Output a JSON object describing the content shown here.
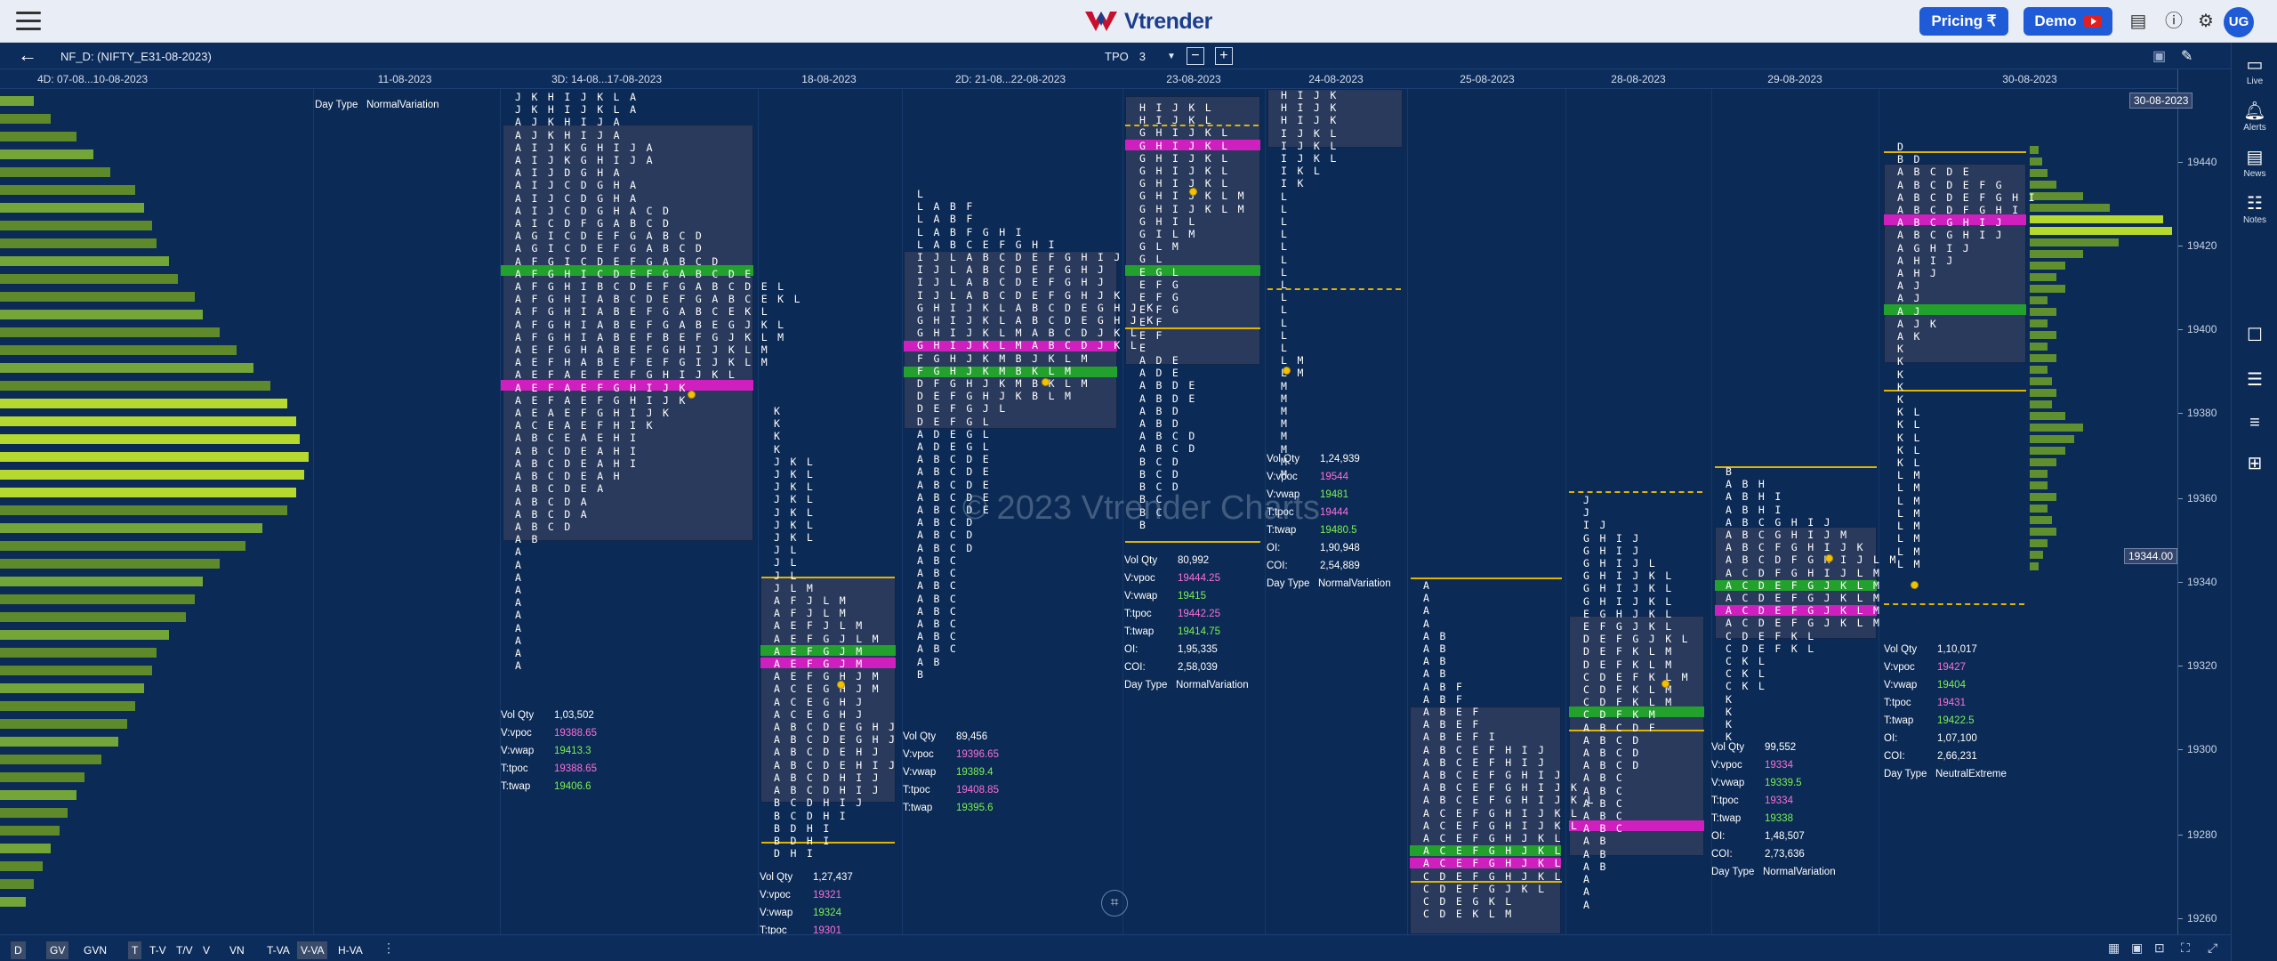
{
  "navbar": {
    "logo_text": "Vtrender",
    "pricing_label": "Pricing ₹",
    "demo_label": "Demo",
    "avatar_initials": "UG",
    "icons": [
      "menu-icon",
      "document-icon",
      "info-icon",
      "gear-icon"
    ]
  },
  "toolbar": {
    "symbol": "NF_D: (NIFTY_E31-08-2023)",
    "tpo_label": "TPO",
    "tpo_value": "3",
    "zoom_out": "−",
    "zoom_in": "+"
  },
  "right_sidebar": {
    "items": [
      {
        "icon": "live-icon",
        "label": "Live"
      },
      {
        "icon": "alerts-icon",
        "label": "Alerts"
      },
      {
        "icon": "news-icon",
        "label": "News"
      },
      {
        "icon": "notes-icon",
        "label": "Notes"
      }
    ]
  },
  "date_headers": [
    "4D: 07-08...10-08-2023",
    "11-08-2023",
    "3D: 14-08...17-08-2023",
    "18-08-2023",
    "2D: 21-08...22-08-2023",
    "23-08-2023",
    "24-08-2023",
    "25-08-2023",
    "28-08-2023",
    "29-08-2023",
    "30-08-2023"
  ],
  "y_axis": {
    "ticks": [
      "19440",
      "19420",
      "19400",
      "19380",
      "19360",
      "19340",
      "19320",
      "19300",
      "19280",
      "19260"
    ],
    "top_label": "30-08-2023",
    "cursor_price": "19344.00"
  },
  "day_type_header": {
    "label": "Day Type",
    "value": "NormalVariation"
  },
  "profiles": {
    "p3d": {
      "rows": [
        "J K H I J K L A",
        "J K H I J K L A",
        "A J K H I J A",
        "A J K H I J A",
        "A I J K G H I J A",
        "A I J K G H I J A",
        "A I J D G H A",
        "A I J C D G H A",
        "A I J C D G H A",
        "A I J C D G H A C D",
        "A I C D F G A B C D",
        "A G I C D E F G A B C D",
        "A G I C D E F G A B C D",
        "A F G I C D E F G A B C D",
        "A F G H I C D E F G A B C D E",
        "A F G H I B C D E F G A B C D E L",
        "A F G H I A B C D E F G A B C E K L",
        "A F G H I A B E F G A B C E K L",
        "A F G H I A B E F G A B E G J K L",
        "A F G H I A B E F B E F G J K L M",
        "A E F G H A B E F G H I J K L M",
        "A E F H A B E F E F G I J K L M",
        "A E F A E F E F G H I J K L",
        "A E F A E F G H I J K",
        "A E F A E F G H I J K",
        "A E A E F G H I J K",
        "A C E A E F H I K",
        "A B C E A E H I",
        "A B C D E A H I",
        "A B C D E A H I",
        "A B C D E A H",
        "A B C D E A",
        "A B C D A",
        "A B C D A",
        "A B C D",
        "A B",
        "A",
        "A",
        "A",
        "A",
        "A",
        "A",
        "A",
        "A",
        "A",
        "A"
      ],
      "vol_qty": "1,03,502",
      "vpoc": "19388.65",
      "vwap": "19413.3",
      "tpoc": "19388.65",
      "twap": "19406.6"
    },
    "p18": {
      "rows": [
        "K",
        "K",
        "K",
        "K",
        "J K L",
        "J K L",
        "J K L",
        "J K L",
        "J K L",
        "J K L",
        "J K L",
        "J L",
        "J L",
        "J L",
        "J L M",
        "A F J L M",
        "A F J L M",
        "A E F J L M",
        "A E F G J L M",
        "A E F G J M",
        "A E F G J M",
        "A E F G H J M",
        "A C E G H J M",
        "A C E G H J",
        "A C E G H J",
        "A B C D E G H J",
        "A B C D E G H J",
        "A B C D E H J",
        "A B C D E H I J",
        "A B C D H I J",
        "A B C D H I J",
        "B C D H I J",
        "B C D H I",
        "B D H I",
        "B D H I",
        "D H I"
      ],
      "vol_qty": "1,27,437",
      "vpoc": "19321",
      "vwap": "19324",
      "tpoc": "19301"
    },
    "p2d": {
      "rows": [
        "L",
        "L A B F",
        "L A B F",
        "L A B F G H I",
        "L A B C E F G H I",
        "I J L A B C D E F G H I J",
        "I J L A B C D E F G H J",
        "I J L A B C D E F G H J",
        "I J L A B C D E F G H J K",
        "G H I J K L A B C D E G H J K",
        "G H I J K L A B C D E G H J K",
        "G H I J K L M A B C D J K L",
        "G H I J K L M A B C D J K L",
        "F G H J K M B J K L M",
        "F G H J K M B K L M",
        "D F G H J K M B K L M",
        "D E F G H J K B L M",
        "D E F G J L",
        "D E F G L",
        "A D E G L",
        "A D E G L",
        "A B C D E",
        "A B C D E",
        "A B C D E",
        "A B C D E",
        "A B C D E",
        "A B C D",
        "A B C D",
        "A B C D",
        "A B C",
        "A B C",
        "A B C",
        "A B C",
        "A B C",
        "A B C",
        "A B C",
        "A B C",
        "A B",
        "B"
      ],
      "vol_qty": "89,456",
      "vpoc": "19396.65",
      "vwap": "19389.4",
      "tpoc": "19408.85",
      "twap": "19395.6"
    },
    "p23": {
      "rows": [
        "H I J K L",
        "H I J K L",
        "G H I J K L",
        "G H I J K L",
        "G H I J K L",
        "G H I J K L",
        "G H I J K L",
        "G H I J K L M",
        "G H I J K L M",
        "G H I L",
        "G I L M",
        "G L M",
        "G L",
        "E G L",
        "E F G",
        "E F G",
        "E F G",
        "E F",
        "E F",
        "E",
        "A D E",
        "A D E",
        "A B D E",
        "A B D E",
        "A B D",
        "A B D",
        "A B C D",
        "A B C D",
        "B C D",
        "B C D",
        "B C D",
        "B C",
        "B C",
        "B"
      ],
      "vol_qty": "80,992",
      "vpoc": "19444.25",
      "vwap": "19415",
      "tpoc": "19442.25",
      "twap": "19414.75",
      "oi": "1,95,335",
      "coi": "2,58,039",
      "day_type": "NormalVariation"
    },
    "p24": {
      "rows": [
        "H I J K",
        "H I J K",
        "H I J K",
        "I J K L",
        "I J K L",
        "I J K L",
        "I K L",
        "I K",
        "L",
        "L",
        "L",
        "L",
        "L",
        "L",
        "L",
        "L",
        "L",
        "L",
        "L",
        "L",
        "L",
        "L M",
        "L M",
        "M",
        "M",
        "M",
        "M",
        "M",
        "M",
        "M",
        "M"
      ],
      "vol_qty": "1,24,939",
      "vpoc": "19544",
      "vwap": "19481",
      "tpoc": "19444",
      "twap": "19480.5",
      "oi": "1,90,948",
      "coi": "2,54,889",
      "day_type": "NormalVariation"
    },
    "p25": {
      "rows": [
        "A",
        "A",
        "A",
        "A",
        "A B",
        "A B",
        "A B",
        "A B",
        "A B F",
        "A B F",
        "A B E F",
        "A B E F",
        "A B E F I",
        "A B C E F H I J",
        "A B C E F H I J",
        "A B C E F G H I J",
        "A B C E F G H I J K",
        "A B C E F G H I J K L",
        "A C E F G H I J K L",
        "A C E F G H I J K L",
        "A C E F G H J K L",
        "A C E F G H J K L",
        "A C E F G H J K L",
        "C D E F G H J K L",
        "C D E F G J K L",
        "C D E G K L",
        "C D E K L M"
      ],
      "vol_qty": "",
      "day_type": ""
    },
    "p28": {
      "rows": [
        "J",
        "J",
        "I J",
        "G H I J",
        "G H I J",
        "G H I J L",
        "G H I J K L",
        "G H I J K L",
        "G H I J K L",
        "E G H J K L",
        "E F G J K L",
        "D E F G J K L",
        "D E F K L M",
        "D E F K L M",
        "C D E F K L M",
        "C D F K L M",
        "C D F K L M",
        "C D F K M",
        "A B C D F",
        "A B C D",
        "A B C D",
        "A B C D",
        "A B C",
        "A B C",
        "A B C",
        "A B C",
        "A B C",
        "A B",
        "A B",
        "A B",
        "A",
        "A",
        "A"
      ],
      "vol_qty": "99,552",
      "vpoc": "19334",
      "vwap": "19339.5",
      "tpoc": "19334",
      "twap": "19338",
      "oi": "1,48,507",
      "coi": "2,73,636",
      "day_type": "NormalVariation"
    },
    "p29": {
      "rows": [
        "B",
        "A B H",
        "A B H I",
        "A B H I",
        "A B C G H I J",
        "A B C G H I J M",
        "A B C F G H I J K",
        "A B C D F G H I J L M",
        "A C D F G H I J L M",
        "A C D E F G J K L M",
        "A C D E F G J K L M",
        "A C D E F G J K L M",
        "A C D E F G J K L M",
        "C D E F K L",
        "C D E F K L",
        "C K L",
        "C K L",
        "C K L",
        "K",
        "K",
        "K",
        "K"
      ],
      "vol_qty": "1,10,017",
      "vpoc": "19427",
      "vwap": "19404",
      "tpoc": "19431",
      "twap": "19422.5",
      "oi": "1,07,100",
      "coi": "2,66,231",
      "day_type": "NeutralExtreme"
    },
    "p30": {
      "rows": [
        "D",
        "B D",
        "A B C D E",
        "A B C D E F G",
        "A B C D E F G H I",
        "A B C D F G H I",
        "A B C G H I J",
        "A B C G H I J",
        "A G H I J",
        "A H I J",
        "A H J",
        "A J",
        "A J",
        "A J",
        "A J K",
        "A K",
        "K",
        "K",
        "K",
        "K",
        "K",
        "K L",
        "K L",
        "K L",
        "K L",
        "K L",
        "L M",
        "L M",
        "L M",
        "L M",
        "L M",
        "L M",
        "L M",
        "L M"
      ],
      "vol_qty": "",
      "day_type": ""
    }
  },
  "stats_labels": {
    "vol_qty": "Vol Qty",
    "vpoc": "V:vpoc",
    "vwap": "V:vwap",
    "tpoc": "T:tpoc",
    "twap": "T:twap",
    "oi": "OI:",
    "coi": "COI:",
    "day_type": "Day Type"
  },
  "watermark": "© 2023 Vtrender Charts",
  "bottom_bar": {
    "buttons": [
      "D",
      "GV",
      "GVN",
      "T",
      "T-V",
      "T/V",
      "V",
      "VN",
      "T-VA",
      "V-VA",
      "H-VA"
    ],
    "active": [
      "D",
      "T",
      "V-VA"
    ]
  },
  "colors": {
    "poc": "#cf1fbf",
    "value_area": "#23a12d",
    "tpo_yellow": "#f2c200",
    "background": "#0b2a55",
    "brand": "#1f5bd6"
  }
}
